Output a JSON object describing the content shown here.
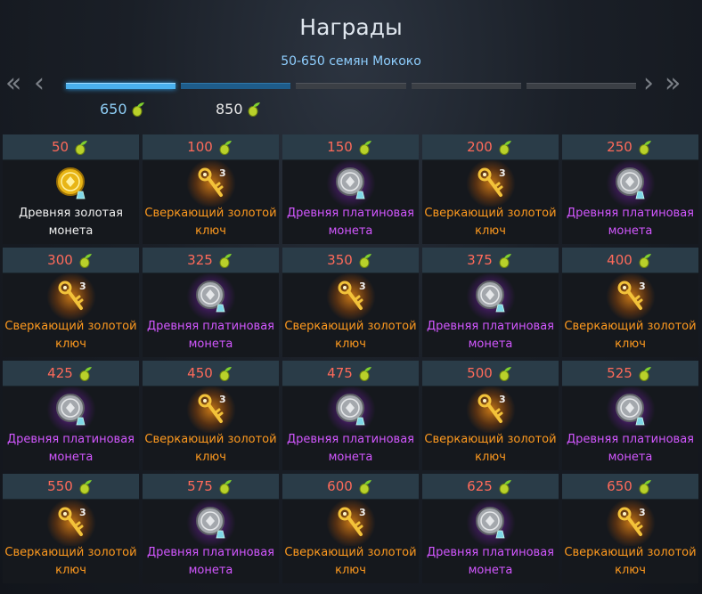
{
  "window": {
    "title": "Награды",
    "subtitle": "50-650 семян Мококо"
  },
  "navigation": {
    "first_label": "«",
    "prev_label": "‹",
    "next_label": "›",
    "last_label": "»"
  },
  "progress": {
    "active_segment": 0,
    "segments_total": 5,
    "milestones": [
      "650",
      "850"
    ]
  },
  "icons": {
    "currency": "mokoko-seed-icon",
    "gold_coin": "ancient-gold-coin-icon",
    "platinum_coin": "ancient-platinum-coin-icon",
    "key": "shining-gold-key-icon"
  },
  "colors": {
    "threshold": "#ff6a5a",
    "grade_gold": "#ff9a1e",
    "grade_purple": "#d257ff",
    "accent": "#4ab0ee"
  },
  "rewards": [
    {
      "threshold": "50",
      "item": "Древняя золотая\nмонета",
      "grade": "white",
      "type": "gold_coin",
      "qty": ""
    },
    {
      "threshold": "100",
      "item": "Сверкающий золотой\nключ",
      "grade": "gold",
      "type": "key",
      "qty": "3"
    },
    {
      "threshold": "150",
      "item": "Древняя платиновая\nмонета",
      "grade": "purple",
      "type": "platinum_coin",
      "qty": ""
    },
    {
      "threshold": "200",
      "item": "Сверкающий золотой\nключ",
      "grade": "gold",
      "type": "key",
      "qty": "3"
    },
    {
      "threshold": "250",
      "item": "Древняя платиновая\nмонета",
      "grade": "purple",
      "type": "platinum_coin",
      "qty": ""
    },
    {
      "threshold": "300",
      "item": "Сверкающий золотой\nключ",
      "grade": "gold",
      "type": "key",
      "qty": "3"
    },
    {
      "threshold": "325",
      "item": "Древняя платиновая\nмонета",
      "grade": "purple",
      "type": "platinum_coin",
      "qty": ""
    },
    {
      "threshold": "350",
      "item": "Сверкающий золотой\nключ",
      "grade": "gold",
      "type": "key",
      "qty": "3"
    },
    {
      "threshold": "375",
      "item": "Древняя платиновая\nмонета",
      "grade": "purple",
      "type": "platinum_coin",
      "qty": ""
    },
    {
      "threshold": "400",
      "item": "Сверкающий золотой\nключ",
      "grade": "gold",
      "type": "key",
      "qty": "3"
    },
    {
      "threshold": "425",
      "item": "Древняя платиновая\nмонета",
      "grade": "purple",
      "type": "platinum_coin",
      "qty": ""
    },
    {
      "threshold": "450",
      "item": "Сверкающий золотой\nключ",
      "grade": "gold",
      "type": "key",
      "qty": "3"
    },
    {
      "threshold": "475",
      "item": "Древняя платиновая\nмонета",
      "grade": "purple",
      "type": "platinum_coin",
      "qty": ""
    },
    {
      "threshold": "500",
      "item": "Сверкающий золотой\nключ",
      "grade": "gold",
      "type": "key",
      "qty": "3"
    },
    {
      "threshold": "525",
      "item": "Древняя платиновая\nмонета",
      "grade": "purple",
      "type": "platinum_coin",
      "qty": ""
    },
    {
      "threshold": "550",
      "item": "Сверкающий золотой\nключ",
      "grade": "gold",
      "type": "key",
      "qty": "3"
    },
    {
      "threshold": "575",
      "item": "Древняя платиновая\nмонета",
      "grade": "purple",
      "type": "platinum_coin",
      "qty": ""
    },
    {
      "threshold": "600",
      "item": "Сверкающий золотой\nключ",
      "grade": "gold",
      "type": "key",
      "qty": "3"
    },
    {
      "threshold": "625",
      "item": "Древняя платиновая\nмонета",
      "grade": "purple",
      "type": "platinum_coin",
      "qty": ""
    },
    {
      "threshold": "650",
      "item": "Сверкающий золотой\nключ",
      "grade": "gold",
      "type": "key",
      "qty": "3"
    }
  ]
}
